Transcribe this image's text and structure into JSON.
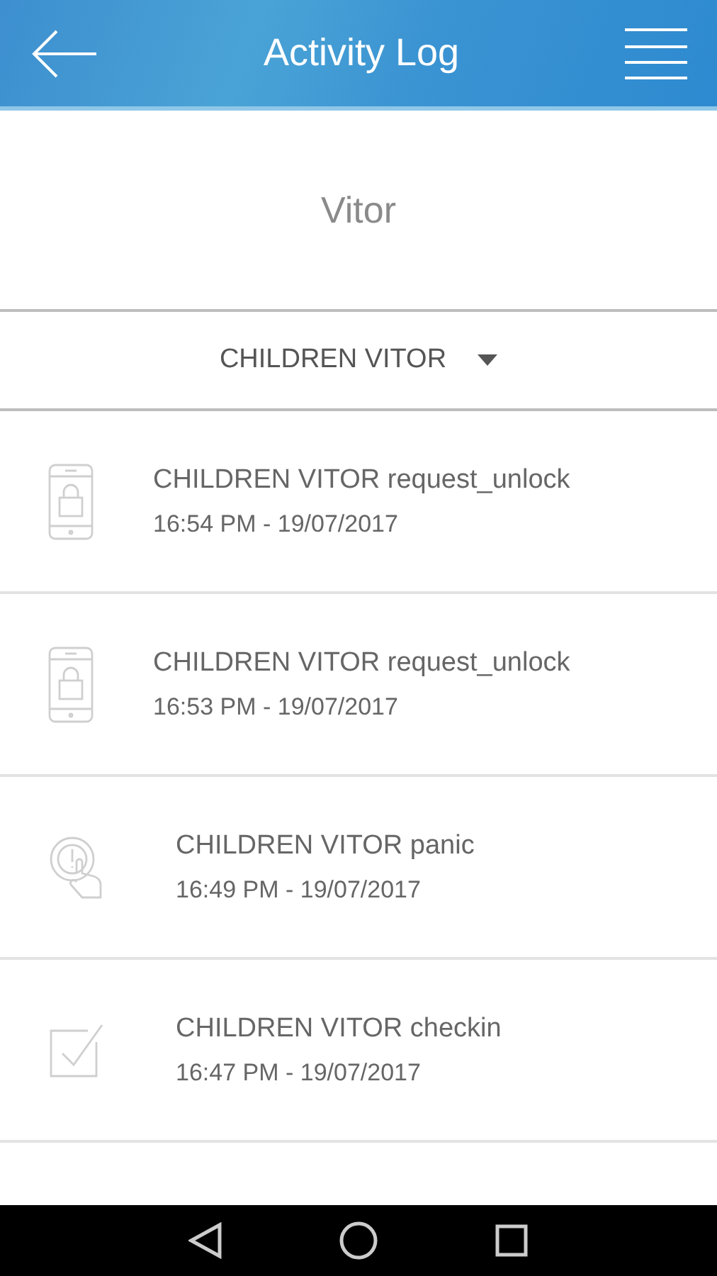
{
  "header": {
    "title": "Activity Log"
  },
  "user": {
    "name": "Vitor"
  },
  "filter": {
    "value": "CHILDREN VITOR"
  },
  "events": [
    {
      "kind": "unlock",
      "text": "CHILDREN VITOR request_unlock",
      "time": "16:54 PM - 19/07/2017"
    },
    {
      "kind": "unlock",
      "text": "CHILDREN VITOR request_unlock",
      "time": "16:53 PM - 19/07/2017"
    },
    {
      "kind": "panic",
      "text": "CHILDREN VITOR panic",
      "time": "16:49 PM - 19/07/2017"
    },
    {
      "kind": "checkin",
      "text": "CHILDREN VITOR checkin",
      "time": "16:47 PM - 19/07/2017"
    }
  ]
}
